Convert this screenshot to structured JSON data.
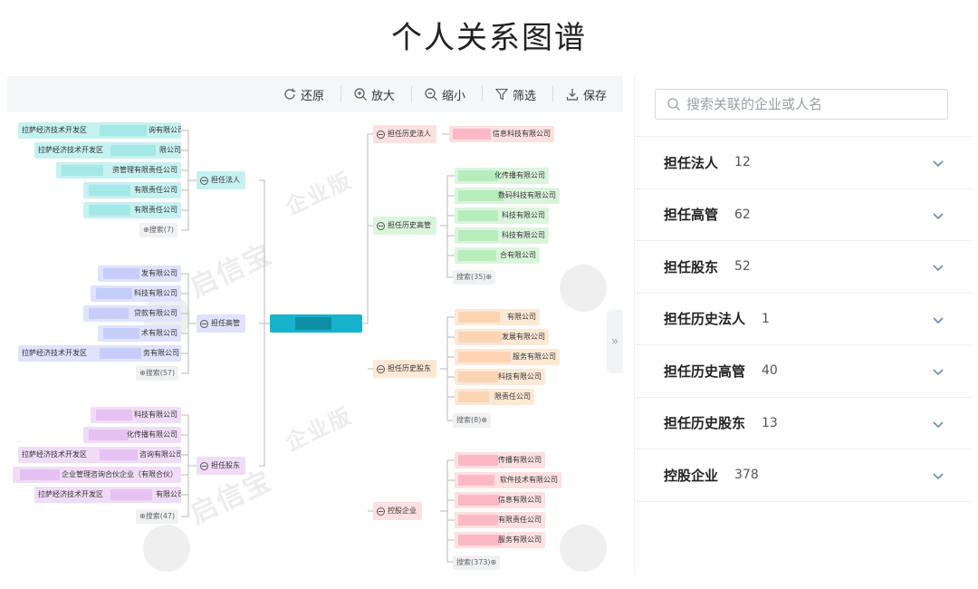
{
  "page_title": "个人关系图谱",
  "toolbar": {
    "restore": "还原",
    "zoom_in": "放大",
    "zoom_out": "缩小",
    "filter": "筛选",
    "save": "保存"
  },
  "graph": {
    "categories": {
      "legal_rep": "担任法人",
      "executive": "担任高管",
      "shareholder": "担任股东",
      "hist_legal_rep": "担任历史法人",
      "hist_executive": "担任历史高管",
      "hist_shareholder": "担任历史股东",
      "holding": "控股企业"
    },
    "legal_rep_nodes": [
      "拉萨经济技术开发区",
      "询有限公司",
      "拉萨经济技术开发区",
      "限公司",
      "资管理有限责任公司",
      "有限责任公司",
      "有限责任公司"
    ],
    "legal_rep_more": "⊕搜索(7)",
    "executive_nodes": [
      "发有限公司",
      "科技有限公司",
      "贷款有限公司",
      "术有限公司",
      "拉萨经济技术开发区",
      "务有限公司"
    ],
    "executive_more": "⊕搜索(57)",
    "shareholder_nodes": [
      "科技有限公司",
      "化传播有限公司",
      "拉萨经济技术开发区",
      "咨询有限公司",
      "企业管理咨询合伙企业（有限合伙）",
      "拉萨经济技术开发区",
      "有限公司"
    ],
    "shareholder_more": "⊕搜索(47)",
    "hist_legal_rep_nodes": [
      "信息科技有限公司"
    ],
    "hist_executive_nodes": [
      "化传播有限公司",
      "数码科技有限公司",
      "科技有限公司",
      "科技有限公司",
      "合有限公司"
    ],
    "hist_executive_more": "搜索(35)⊕",
    "hist_shareholder_nodes": [
      "有限公司",
      "发展有限公司",
      "服务有限公司",
      "科技有限公司",
      "限责任公司"
    ],
    "hist_shareholder_more": "搜索(8)⊕",
    "holding_nodes": [
      "传播有限公司",
      "软件技术有限公司",
      "信息有限公司",
      "有限责任公司",
      "服务有限公司"
    ],
    "holding_more": "搜索(373)⊕",
    "watermark_text": "启信宝",
    "watermark_text2": "企业版"
  },
  "side_panel": {
    "search_placeholder": "搜索关联的企业或人名",
    "categories": [
      {
        "label": "担任法人",
        "count": "12"
      },
      {
        "label": "担任高管",
        "count": "62"
      },
      {
        "label": "担任股东",
        "count": "52"
      },
      {
        "label": "担任历史法人",
        "count": "1"
      },
      {
        "label": "担任历史高管",
        "count": "40"
      },
      {
        "label": "担任历史股东",
        "count": "13"
      },
      {
        "label": "控股企业",
        "count": "378"
      }
    ]
  },
  "colors": {
    "center": "#17b2cc",
    "legal_rep": "#c6f1f1",
    "executive": "#dfe3fb",
    "shareholder": "#f1dcf7",
    "hist_legal_rep": "#fde0e0",
    "hist_executive": "#dbf5dd",
    "hist_shareholder": "#fde8d6",
    "holding": "#fde0e0"
  }
}
